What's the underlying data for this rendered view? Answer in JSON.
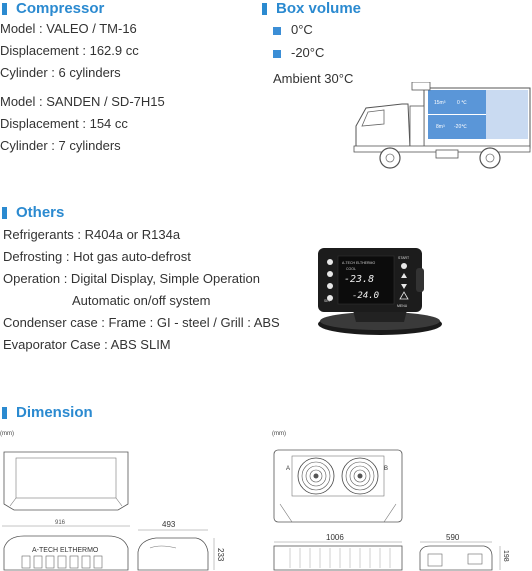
{
  "compressor": {
    "heading": "Compressor",
    "unit1": [
      "Model : VALEO / TM-16",
      "Displacement : 162.9 cc",
      "Cylinder : 6 cylinders"
    ],
    "unit2": [
      "Model : SANDEN / SD-7H15",
      "Displacement : 154 cc",
      "Cylinder : 7 cylinders"
    ]
  },
  "box_volume": {
    "heading": "Box volume",
    "items": [
      "0°C",
      "-20°C"
    ],
    "ambient": "Ambient 30°C",
    "truck_labels": {
      "row1_left": "15m³",
      "row1_right": "0 ℃",
      "row2_left": "8m³",
      "row2_right": "-20℃"
    }
  },
  "others": {
    "heading": "Others",
    "lines": [
      "Refrigerants : R404a or R134a",
      "Defrosting : Hot gas auto-defrost",
      "Operation : Digital Display, Simple Operation",
      "Automatic on/off system",
      "Condenser case : Frame : GI - steel / Grill : ABS",
      "Evaporator Case : ABS SLIM"
    ],
    "controller": {
      "brand": "A-TECH ELTHERMO",
      "temp1": "-23.8",
      "temp2": "-24.0",
      "mode": "COOL",
      "start": "START",
      "menu": "MENU",
      "set": "SET"
    }
  },
  "dimension": {
    "heading": "Dimension",
    "unit_left": "(mm)",
    "unit_right": "(mm)",
    "left_width": "916",
    "left_brand": "A-TECH ELTHERMO",
    "left_depth": "493",
    "left_height": "233",
    "right_label_a": "A",
    "right_label_b": "B",
    "right_width": "1006",
    "right_depth": "590",
    "right_height": "198"
  },
  "colors": {
    "accent": "#2b8ad0",
    "truck_box": "#5a96d8"
  }
}
